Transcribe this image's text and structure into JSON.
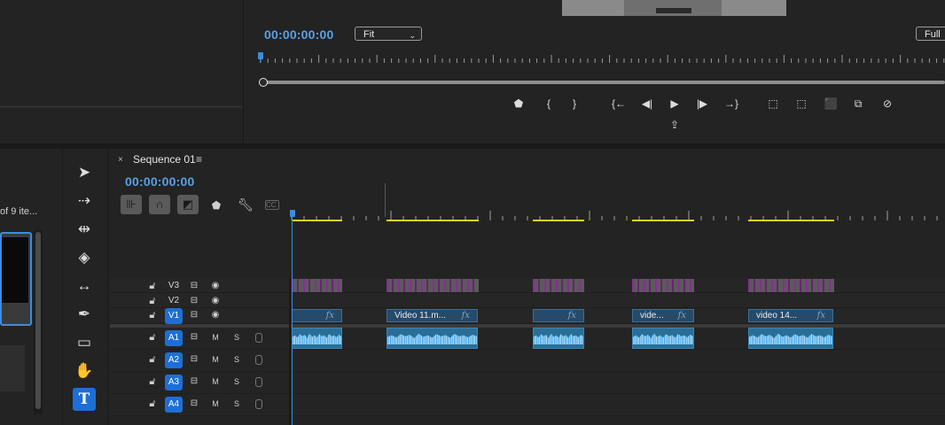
{
  "program_monitor": {
    "timecode": "00:00:00:00",
    "zoom_select": "Fit",
    "resolution_select": "Full",
    "controls": [
      {
        "name": "add-marker-icon",
        "glyph": "⬟"
      },
      {
        "name": "mark-in-icon",
        "glyph": "{"
      },
      {
        "name": "mark-out-icon",
        "glyph": "}"
      },
      {
        "name": "go-to-in-icon",
        "glyph": "{←"
      },
      {
        "name": "step-back-icon",
        "glyph": "◀|"
      },
      {
        "name": "play-icon",
        "glyph": "▶"
      },
      {
        "name": "step-forward-icon",
        "glyph": "|▶"
      },
      {
        "name": "go-to-out-icon",
        "glyph": "→}"
      },
      {
        "name": "lift-icon",
        "glyph": "⬚"
      },
      {
        "name": "extract-icon",
        "glyph": "⬚"
      },
      {
        "name": "export-frame-icon",
        "glyph": "⬛"
      },
      {
        "name": "compare-view-icon",
        "glyph": "⧉"
      },
      {
        "name": "proxy-toggle-icon",
        "glyph": "⊘"
      },
      {
        "name": "export-icon",
        "glyph": "⇪"
      }
    ]
  },
  "project": {
    "count_text": "of 9 ite..."
  },
  "tools": [
    {
      "name": "selection-tool-icon",
      "glyph": "➤"
    },
    {
      "name": "track-select-tool-icon",
      "glyph": "⇢"
    },
    {
      "name": "ripple-edit-tool-icon",
      "glyph": "⇹"
    },
    {
      "name": "razor-tool-icon",
      "glyph": "◈"
    },
    {
      "name": "slip-tool-icon",
      "glyph": "↔"
    },
    {
      "name": "pen-tool-icon",
      "glyph": "✒"
    },
    {
      "name": "rectangle-tool-icon",
      "glyph": "▭"
    },
    {
      "name": "hand-tool-icon",
      "glyph": "✋"
    },
    {
      "name": "type-tool-icon",
      "glyph": "T"
    }
  ],
  "timeline": {
    "sequence_name": "Sequence 01",
    "close_glyph": "×",
    "menu_glyph": "≡",
    "timecode": "00:00:00:00",
    "cc_label": "CC",
    "video_tracks": [
      {
        "label": "V3",
        "targeted": false
      },
      {
        "label": "V2",
        "targeted": false
      },
      {
        "label": "V1",
        "targeted": true
      }
    ],
    "audio_tracks": [
      {
        "label": "A1",
        "mute": "M",
        "solo": "S"
      },
      {
        "label": "A2",
        "mute": "M",
        "solo": "S"
      },
      {
        "label": "A3",
        "mute": "M",
        "solo": "S"
      },
      {
        "label": "A4",
        "mute": "M",
        "solo": "S"
      }
    ],
    "v1_clips": [
      {
        "label": "",
        "fx": "fx"
      },
      {
        "label": "Video 11.m...",
        "fx": "fx"
      },
      {
        "label": "",
        "fx": "fx"
      },
      {
        "label": "vide...",
        "fx": "fx"
      },
      {
        "label": "video 14...",
        "fx": "fx"
      }
    ]
  },
  "colors": {
    "accent": "#1d6fd6",
    "timecode": "#5aa0e6",
    "work_area": "#e3d31a",
    "video_clip": "#254a6a",
    "audio_clip": "#2a6e97",
    "v3_clip_stripes": "#8d2a9a"
  }
}
